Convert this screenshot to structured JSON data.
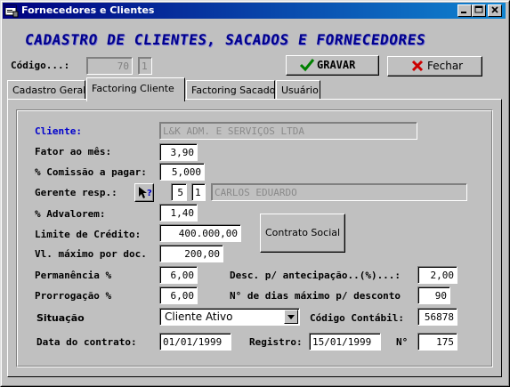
{
  "window": {
    "title": "Fornecedores e Clientes",
    "icons": {
      "app": "app-window-icon",
      "minimize": "minimize-icon",
      "maximize": "maximize-icon",
      "close": "close-icon"
    }
  },
  "header": {
    "title": "CADASTRO DE  CLIENTES, SACADOS E FORNECEDORES",
    "codigo_label": "Código...:",
    "codigo_value": "70",
    "codigo_digit": "1"
  },
  "actions": {
    "save_label": "GRAVAR",
    "save_icon": "checkmark-icon",
    "close_label": "Fechar",
    "close_icon": "x-icon"
  },
  "tabs": [
    {
      "label": "Cadastro Geral",
      "active": false
    },
    {
      "label": "Factoring Cliente",
      "active": true
    },
    {
      "label": "Factoring  Sacado",
      "active": false
    },
    {
      "label": "Usuário",
      "active": false
    }
  ],
  "form": {
    "cliente_label": "Cliente:",
    "cliente_value": "L&K ADM. E SERVIÇOS LTDA",
    "fator_label": "Fator ao mês:",
    "fator_value": "3,90",
    "comissao_label": "% Comissão a pagar:",
    "comissao_value": "5,000",
    "gerente_label": "Gerente resp.:",
    "gerente_help_icon": "help-pointer-icon",
    "gerente_code": "5",
    "gerente_digit": "1",
    "gerente_name": "CARLOS EDUARDO",
    "advalorem_label": "% Advalorem:",
    "advalorem_value": "1,40",
    "limite_label": "Limite de Crédito:",
    "limite_value": "400.000,00",
    "vlmax_label": "Vl. máximo por doc.",
    "vlmax_value": "200,00",
    "contrato_button": "Contrato Social",
    "permanencia_label": "Permanência %",
    "permanencia_value": "6,00",
    "desconto_label": "Desc. p/ antecipação..(%)...:",
    "desconto_value": "2,00",
    "prorrogacao_label": "Prorrogação %",
    "prorrogacao_value": "6,00",
    "dias_label": "N° de dias máximo p/ desconto",
    "dias_value": "90",
    "situacao_label": "Situação",
    "situacao_value": "Cliente Ativo",
    "situacao_icon": "dropdown-arrow-icon",
    "contabil_label": "Código Contábil:",
    "contabil_value": "56878",
    "data_label": "Data do contrato:",
    "data_value": "01/01/1999",
    "registro_label": "Registro:",
    "registro_value": "15/01/1999",
    "numero_label": "N°",
    "numero_value": "175"
  }
}
